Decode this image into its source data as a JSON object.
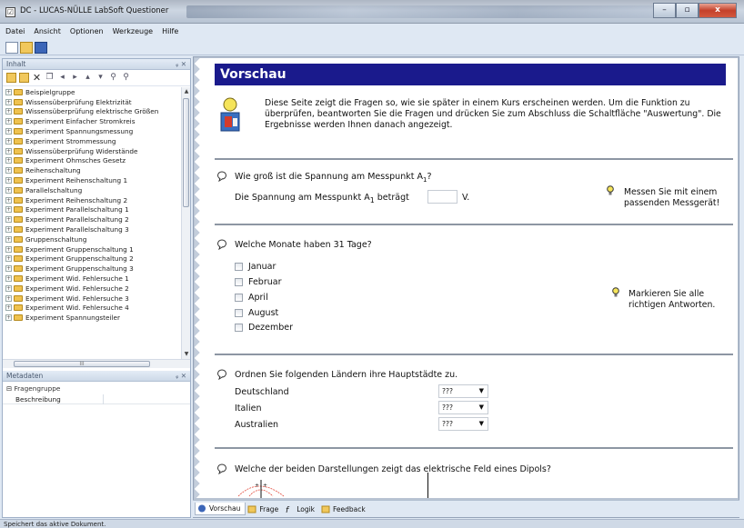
{
  "window": {
    "title": "DC - LUCAS-NÜLLE LabSoft Questioner",
    "minimize": "–",
    "maximize": "▫",
    "close": "x"
  },
  "menu": [
    "Datei",
    "Ansicht",
    "Optionen",
    "Werkzeuge",
    "Hilfe"
  ],
  "left_pane": {
    "title": "Inhalt",
    "pin": "ᵩ ✕",
    "tree": [
      "Beispielgruppe",
      "Wissensüberprüfung Elektrizität",
      "Wissensüberprüfung elektrische Größen",
      "Experiment Einfacher Stromkreis",
      "Experiment Spannungsmessung",
      "Experiment Strommessung",
      "Wissensüberprüfung Widerstände",
      "Experiment Ohmsches Gesetz",
      "Reihenschaltung",
      "Experiment Reihenschaltung 1",
      "Parallelschaltung",
      "Experiment Reihenschaltung 2",
      "Experiment Parallelschaltung 1",
      "Experiment Parallelschaltung 2",
      "Experiment Parallelschaltung 3",
      "Gruppenschaltung",
      "Experiment Gruppenschaltung 1",
      "Experiment Gruppenschaltung 2",
      "Experiment Gruppenschaltung 3",
      "Experiment Wid. Fehlersuche 1",
      "Experiment Wid. Fehlersuche 2",
      "Experiment Wid. Fehlersuche 3",
      "Experiment Wid. Fehlersuche 4",
      "Experiment Spannungsteiler"
    ]
  },
  "metadata": {
    "title": "Metadaten",
    "pin": "ᵩ ✕",
    "group": "Fragengruppe",
    "property": "Beschreibung"
  },
  "preview": {
    "heading": "Vorschau",
    "intro": "Diese Seite zeigt die Fragen so, wie sie später in einem Kurs erscheinen werden. Um die Funktion zu überprüfen, beantworten Sie die Fragen und drücken Sie zum Abschluss die Schaltfläche \"Auswertung\". Die Ergebnisse werden Ihnen danach angezeigt.",
    "q1": {
      "title": "Wie groß ist die Spannung am Messpunkt A",
      "title_sub": "1",
      "title_end": "?",
      "line": "Die Spannung am Messpunkt A",
      "line_sub": "1",
      "line_end": " beträgt",
      "unit": "V.",
      "hint": "Messen Sie mit einem passenden Messgerät!"
    },
    "q2": {
      "title": "Welche Monate haben 31 Tage?",
      "options": [
        "Januar",
        "Februar",
        "April",
        "August",
        "Dezember"
      ],
      "hint": "Markieren Sie alle richtigen Antworten."
    },
    "q3": {
      "title": "Ordnen Sie folgenden Ländern ihre Hauptstädte zu.",
      "rows": [
        {
          "country": "Deutschland",
          "value": "???"
        },
        {
          "country": "Italien",
          "value": "???"
        },
        {
          "country": "Australien",
          "value": "???"
        }
      ]
    },
    "q4": {
      "title": "Welche der beiden Darstellungen zeigt das elektrische Feld eines Dipols?"
    }
  },
  "tabs": [
    "Vorschau",
    "Frage",
    "Logik",
    "Feedback"
  ],
  "status": "Speichert das aktive Dokument.",
  "colors": {
    "banner": "#1a1a8c",
    "accent": "#3c66b8"
  }
}
